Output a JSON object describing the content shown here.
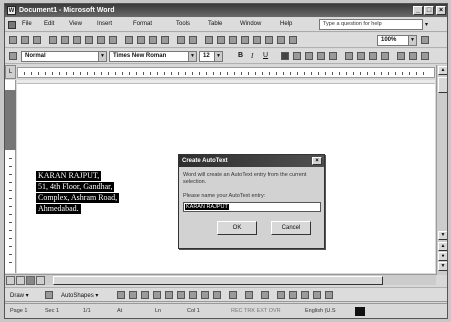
{
  "window": {
    "title": "Document1 - Microsoft Word",
    "minimize": "_",
    "maximize": "□",
    "close": "×"
  },
  "menubar": {
    "items": [
      "File",
      "Edit",
      "View",
      "Insert",
      "Format",
      "Tools",
      "Table",
      "Window",
      "Help"
    ],
    "help_placeholder": "Type a question for help",
    "help_dropdown": "▾"
  },
  "toolbar": {
    "zoom": "100%"
  },
  "formatting": {
    "style": "Normal",
    "font": "Times New Roman",
    "size": "12",
    "bold": "B",
    "italic": "I",
    "underline": "U"
  },
  "ruler_corner": "L",
  "document": {
    "lines": [
      "KARAN RAJPUT,",
      "51, 4th Floor, Gandhar,",
      "Complex, Ashram Road,",
      "Ahmedabad."
    ]
  },
  "dialog": {
    "title": "Create AutoText",
    "close": "×",
    "message": "Word will create an AutoText entry from the current selection.",
    "prompt": "Please name your AutoText entry:",
    "input_value": "KARAN RAJPUT",
    "ok_label": "OK",
    "cancel_label": "Cancel"
  },
  "drawbar": {
    "draw_label": "Draw ▾",
    "autoshapes_label": "AutoShapes ▾"
  },
  "statusbar": {
    "page": "Page 1",
    "section": "Sec 1",
    "page_of": "1/1",
    "at": "At",
    "ln": "Ln",
    "col": "Col 1",
    "indicators": "REC  TRK  EXT  OVR",
    "language": "English (U.S"
  }
}
